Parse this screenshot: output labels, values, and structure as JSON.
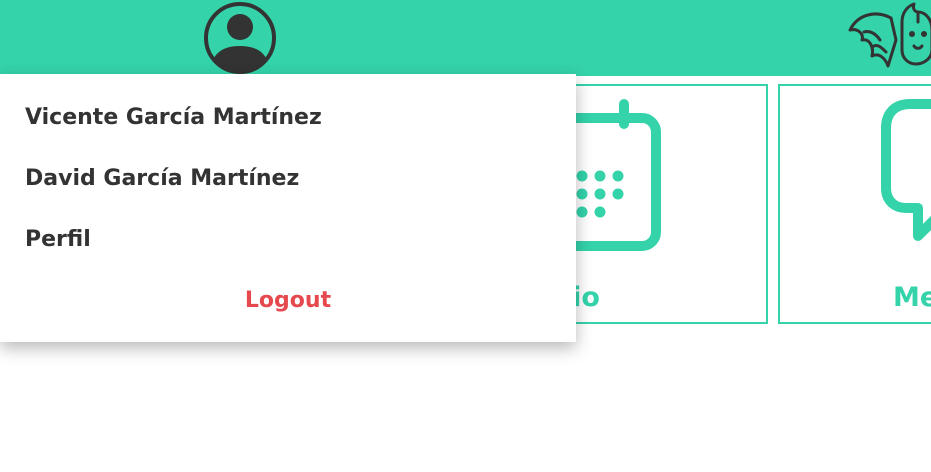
{
  "header": {
    "background_color": "#34d3aa",
    "avatar_icon": "user-avatar-icon",
    "logo_icon": "dragon-logo-icon"
  },
  "cards": [
    {
      "label": "ndario",
      "icon": "calendar-icon"
    },
    {
      "label": "Me",
      "icon": "message-bubble-icon"
    }
  ],
  "user_menu": {
    "items": [
      "Vicente García Martínez",
      "David García Martínez",
      "Perfil"
    ],
    "logout_label": "Logout",
    "logout_color": "#e5484d"
  },
  "colors": {
    "accent": "#34d3aa",
    "text": "#333333"
  }
}
